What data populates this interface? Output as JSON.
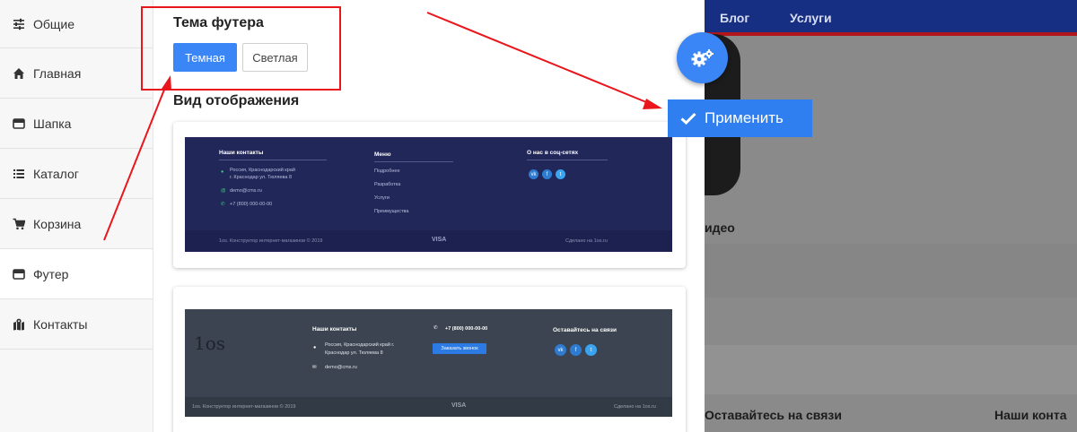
{
  "sidebar": {
    "items": [
      {
        "label": "Общие",
        "icon": "sliders-icon"
      },
      {
        "label": "Главная",
        "icon": "home-icon"
      },
      {
        "label": "Шапка",
        "icon": "window-icon"
      },
      {
        "label": "Каталог",
        "icon": "list-icon"
      },
      {
        "label": "Корзина",
        "icon": "cart-icon"
      },
      {
        "label": "Футер",
        "icon": "window-icon",
        "active": true
      },
      {
        "label": "Контакты",
        "icon": "map-icon"
      }
    ]
  },
  "panel": {
    "theme_title": "Тема футера",
    "dark_label": "Темная",
    "light_label": "Светлая",
    "view_title": "Вид отображения"
  },
  "preview1": {
    "contacts_title": "Наши контакты",
    "address": "Россия, Краснодарский край",
    "address2": "г. Краснодар ул. Тюляева 8",
    "email": "demo@cms.ru",
    "phone": "+7 (800) 000-00-00",
    "menu_title": "Меню",
    "menu_items": [
      "Подробнее",
      "Разработка",
      "Услуги",
      "Преимущества"
    ],
    "social_title": "О нас в соц-сетях",
    "copyright": "1os. Конструктор интернет-магазинов © 2019",
    "made_by": "Сделано на 1os.ru",
    "payment": "VISA"
  },
  "preview2": {
    "logo": "1os",
    "contacts_title": "Наши контакты",
    "address": "Россия, Краснодарский край г.",
    "address2": "Краснодар ул. Тюляева 8",
    "email": "demo@cms.ru",
    "phone": "+7 (800) 000-00-00",
    "call_button": "Заказать звонок",
    "social_title": "Оставайтесь на связи",
    "copyright": "1os. Конструктор интернет-магазинов © 2019",
    "made_by": "Сделано на 1os.ru",
    "payment": "VISA"
  },
  "site": {
    "nav": [
      "Блог",
      "Услуги"
    ],
    "video_text": "идео",
    "stay_connected": "Оставайтесь на связи",
    "our_contacts": "Наши конта"
  },
  "apply_label": "Применить",
  "colors": {
    "accent": "#3b86f7",
    "annotation": "#e9161c"
  }
}
